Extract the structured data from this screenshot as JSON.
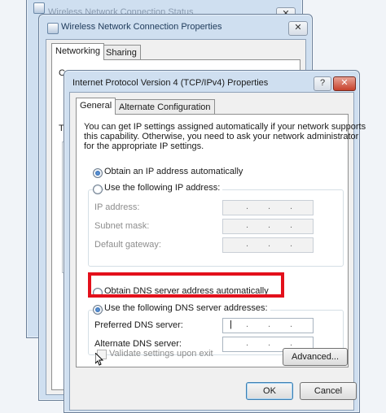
{
  "back_window": {
    "title": "Wireless Network Connection Status",
    "close_label": "✕"
  },
  "middle_window": {
    "title": "Wireless Network Connection Properties",
    "tabs": [
      "Networking",
      "Sharing"
    ],
    "close_label": "✕",
    "partial_glyphs": [
      "C",
      "T"
    ]
  },
  "dialog": {
    "title": "Internet Protocol Version 4 (TCP/IPv4) Properties",
    "help_label": "?",
    "close_label": "✕",
    "tabs": [
      "General",
      "Alternate Configuration"
    ],
    "description": [
      "You can get IP settings assigned automatically if your network supports",
      "this capability. Otherwise, you need to ask your network administrator",
      "for the appropriate IP settings."
    ],
    "ip_options": {
      "auto_label": "Obtain an IP address automatically",
      "manual_label": "Use the following IP address:",
      "selected": "auto"
    },
    "ip_fields": [
      {
        "label": "IP address:",
        "value": ""
      },
      {
        "label": "Subnet mask:",
        "value": ""
      },
      {
        "label": "Default gateway:",
        "value": ""
      }
    ],
    "dns_options": {
      "auto_label": "Obtain DNS server address automatically",
      "manual_label": "Use the following DNS server addresses:",
      "selected": "manual"
    },
    "dns_fields": [
      {
        "label": "Preferred DNS server:",
        "value": ""
      },
      {
        "label": "Alternate DNS server:",
        "value": ""
      }
    ],
    "validate_label": "Validate settings upon exit",
    "advanced_label": "Advanced...",
    "ok_label": "OK",
    "cancel_label": "Cancel"
  },
  "colors": {
    "highlight": "#e3101b",
    "title_text": "#1e3a5a"
  }
}
